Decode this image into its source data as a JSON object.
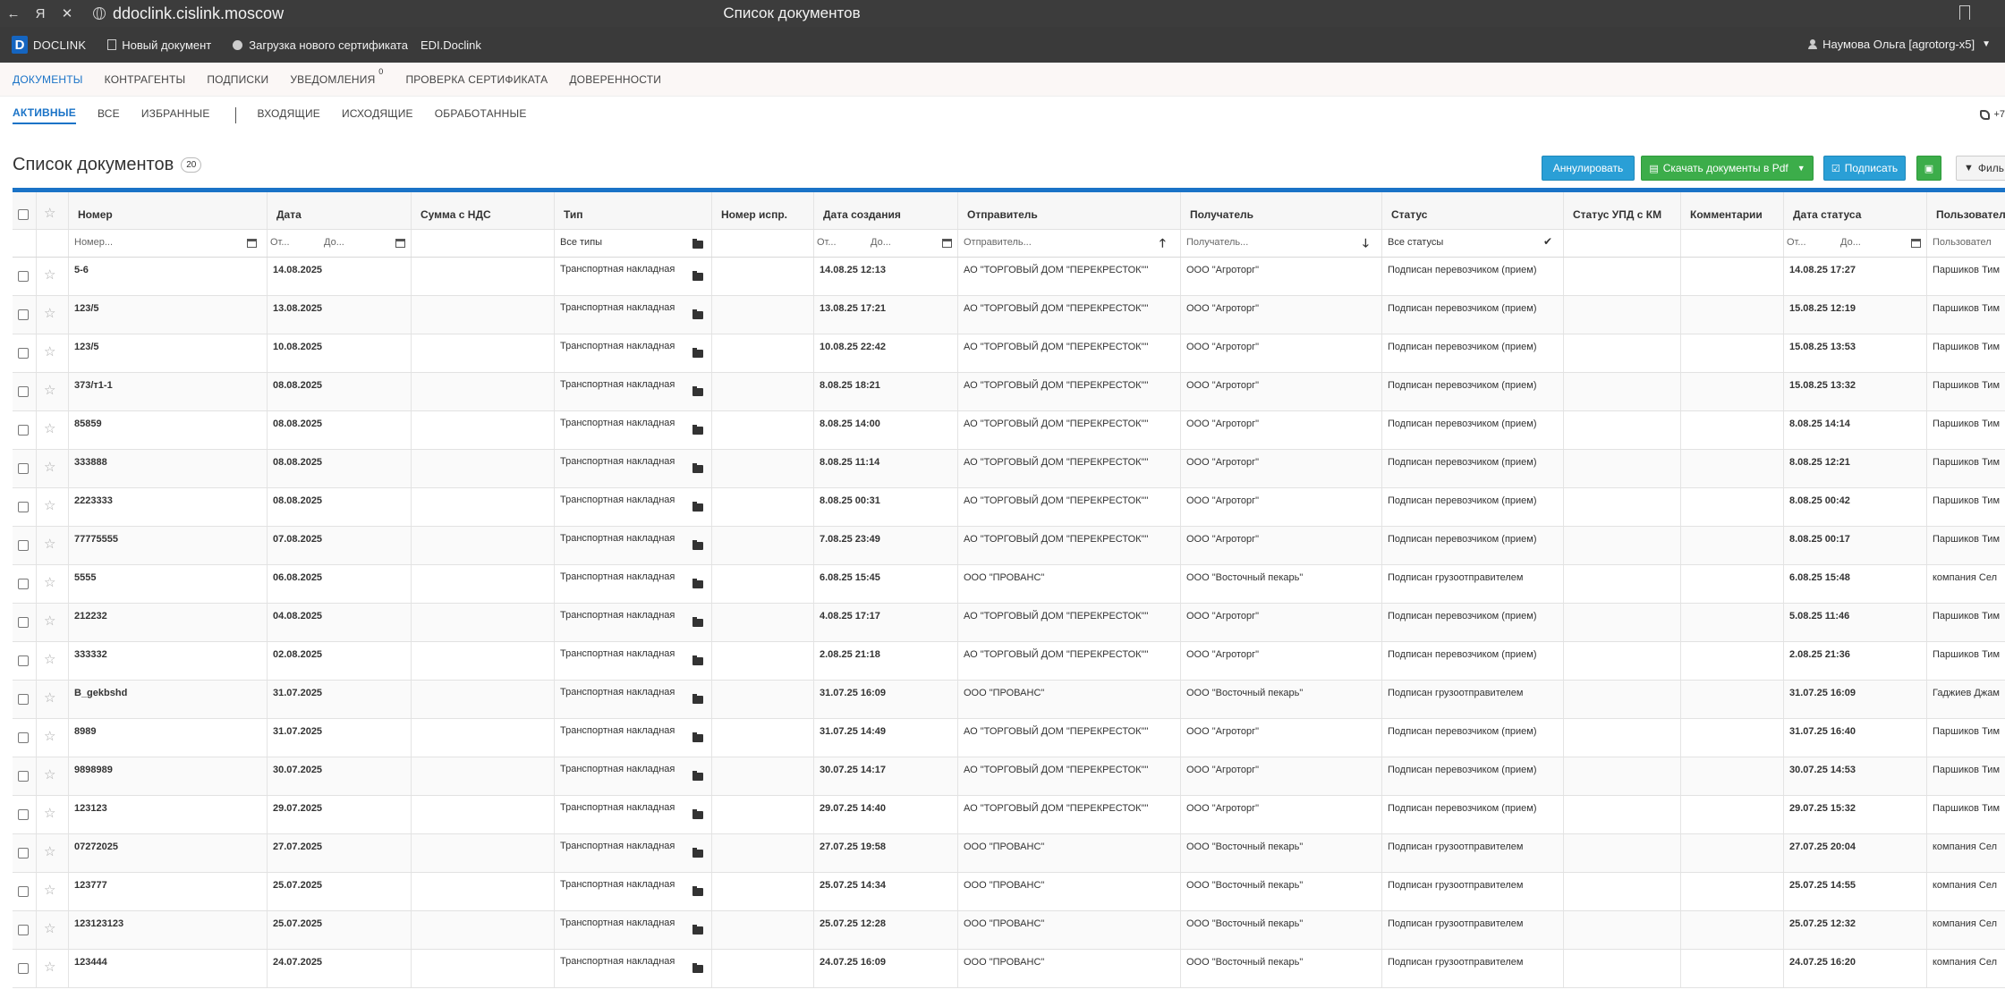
{
  "browser": {
    "url": "ddoclink.cislink.moscow",
    "tab_title": "Список документов"
  },
  "topbar": {
    "logo_letter": "D",
    "logo_text": "DOCLINK",
    "items": [
      "Новый документ",
      "Загрузка нового сертификата",
      "EDI.Doclink"
    ],
    "user": "Наумова Ольга [agrotorg-x5]"
  },
  "mainnav": {
    "items": [
      "ДОКУМЕНТЫ",
      "КОНТРАГЕНТЫ",
      "ПОДПИСКИ",
      "УВЕДОМЛЕНИЯ",
      "ПРОВЕРКА СЕРТИФИКАТА",
      "ДОВЕРЕННОСТИ"
    ],
    "notifications_count": "0"
  },
  "subnav": {
    "items": [
      "АКТИВНЫЕ",
      "ВСЕ",
      "ИЗБРАННЫЕ",
      "ВХОДЯЩИЕ",
      "ИСХОДЯЩИЕ",
      "ОБРАБОТАННЫЕ"
    ],
    "phone": "+7"
  },
  "page": {
    "title": "Список документов",
    "count": "20"
  },
  "toolbar": {
    "annul": "Аннулировать",
    "download_pdf": "Скачать документы в Pdf",
    "sign": "Подписать",
    "filter": "Филь"
  },
  "columns": [
    "Номер",
    "Дата",
    "Сумма с НДС",
    "Тип",
    "Номер испр.",
    "Дата создания",
    "Отправитель",
    "Получатель",
    "Статус",
    "Статус УПД с КМ",
    "Комментарии",
    "Дата статуса",
    "Пользовател"
  ],
  "filters": {
    "number_ph": "Номер...",
    "from": "От...",
    "to": "До...",
    "types": "Все типы",
    "sender_ph": "Отправитель...",
    "recipient_ph": "Получатель...",
    "statuses": "Все статусы",
    "user_ph": "Пользовател"
  },
  "rows": [
    [
      "5-6",
      "14.08.2025",
      "Транспортная накладная",
      "14.08.25 12:13",
      "АО \"ТОРГОВЫЙ ДОМ \"ПЕРЕКРЕСТОК\"\"",
      "ООО \"Агроторг\"",
      "Подписан перевозчиком (прием)",
      "14.08.25 17:27",
      "Паршиков Тим"
    ],
    [
      "123/5",
      "13.08.2025",
      "Транспортная накладная",
      "13.08.25 17:21",
      "АО \"ТОРГОВЫЙ ДОМ \"ПЕРЕКРЕСТОК\"\"",
      "ООО \"Агроторг\"",
      "Подписан перевозчиком (прием)",
      "15.08.25 12:19",
      "Паршиков Тим"
    ],
    [
      "123/5",
      "10.08.2025",
      "Транспортная накладная",
      "10.08.25 22:42",
      "АО \"ТОРГОВЫЙ ДОМ \"ПЕРЕКРЕСТОК\"\"",
      "ООО \"Агроторг\"",
      "Подписан перевозчиком (прием)",
      "15.08.25 13:53",
      "Паршиков Тим"
    ],
    [
      "373/т1-1",
      "08.08.2025",
      "Транспортная накладная",
      "8.08.25 18:21",
      "АО \"ТОРГОВЫЙ ДОМ \"ПЕРЕКРЕСТОК\"\"",
      "ООО \"Агроторг\"",
      "Подписан перевозчиком (прием)",
      "15.08.25 13:32",
      "Паршиков Тим"
    ],
    [
      "85859",
      "08.08.2025",
      "Транспортная накладная",
      "8.08.25 14:00",
      "АО \"ТОРГОВЫЙ ДОМ \"ПЕРЕКРЕСТОК\"\"",
      "ООО \"Агроторг\"",
      "Подписан перевозчиком (прием)",
      "8.08.25 14:14",
      "Паршиков Тим"
    ],
    [
      "333888",
      "08.08.2025",
      "Транспортная накладная",
      "8.08.25 11:14",
      "АО \"ТОРГОВЫЙ ДОМ \"ПЕРЕКРЕСТОК\"\"",
      "ООО \"Агроторг\"",
      "Подписан перевозчиком (прием)",
      "8.08.25 12:21",
      "Паршиков Тим"
    ],
    [
      "2223333",
      "08.08.2025",
      "Транспортная накладная",
      "8.08.25 00:31",
      "АО \"ТОРГОВЫЙ ДОМ \"ПЕРЕКРЕСТОК\"\"",
      "ООО \"Агроторг\"",
      "Подписан перевозчиком (прием)",
      "8.08.25 00:42",
      "Паршиков Тим"
    ],
    [
      "77775555",
      "07.08.2025",
      "Транспортная накладная",
      "7.08.25 23:49",
      "АО \"ТОРГОВЫЙ ДОМ \"ПЕРЕКРЕСТОК\"\"",
      "ООО \"Агроторг\"",
      "Подписан перевозчиком (прием)",
      "8.08.25 00:17",
      "Паршиков Тим"
    ],
    [
      "5555",
      "06.08.2025",
      "Транспортная накладная",
      "6.08.25 15:45",
      "ООО \"ПРОВАНС\"",
      "ООО \"Восточный пекарь\"",
      "Подписан грузоотправителем",
      "6.08.25 15:48",
      "компания Сел"
    ],
    [
      "212232",
      "04.08.2025",
      "Транспортная накладная",
      "4.08.25 17:17",
      "АО \"ТОРГОВЫЙ ДОМ \"ПЕРЕКРЕСТОК\"\"",
      "ООО \"Агроторг\"",
      "Подписан перевозчиком (прием)",
      "5.08.25 11:46",
      "Паршиков Тим"
    ],
    [
      "333332",
      "02.08.2025",
      "Транспортная накладная",
      "2.08.25 21:18",
      "АО \"ТОРГОВЫЙ ДОМ \"ПЕРЕКРЕСТОК\"\"",
      "ООО \"Агроторг\"",
      "Подписан перевозчиком (прием)",
      "2.08.25 21:36",
      "Паршиков Тим"
    ],
    [
      "B_gekbshd",
      "31.07.2025",
      "Транспортная накладная",
      "31.07.25 16:09",
      "ООО \"ПРОВАНС\"",
      "ООО \"Восточный пекарь\"",
      "Подписан грузоотправителем",
      "31.07.25 16:09",
      "Гаджиев Джам"
    ],
    [
      "8989",
      "31.07.2025",
      "Транспортная накладная",
      "31.07.25 14:49",
      "АО \"ТОРГОВЫЙ ДОМ \"ПЕРЕКРЕСТОК\"\"",
      "ООО \"Агроторг\"",
      "Подписан перевозчиком (прием)",
      "31.07.25 16:40",
      "Паршиков Тим"
    ],
    [
      "9898989",
      "30.07.2025",
      "Транспортная накладная",
      "30.07.25 14:17",
      "АО \"ТОРГОВЫЙ ДОМ \"ПЕРЕКРЕСТОК\"\"",
      "ООО \"Агроторг\"",
      "Подписан перевозчиком (прием)",
      "30.07.25 14:53",
      "Паршиков Тим"
    ],
    [
      "123123",
      "29.07.2025",
      "Транспортная накладная",
      "29.07.25 14:40",
      "АО \"ТОРГОВЫЙ ДОМ \"ПЕРЕКРЕСТОК\"\"",
      "ООО \"Агроторг\"",
      "Подписан перевозчиком (прием)",
      "29.07.25 15:32",
      "Паршиков Тим"
    ],
    [
      "07272025",
      "27.07.2025",
      "Транспортная накладная",
      "27.07.25 19:58",
      "ООО \"ПРОВАНС\"",
      "ООО \"Восточный пекарь\"",
      "Подписан грузоотправителем",
      "27.07.25 20:04",
      "компания Сел"
    ],
    [
      "123777",
      "25.07.2025",
      "Транспортная накладная",
      "25.07.25 14:34",
      "ООО \"ПРОВАНС\"",
      "ООО \"Восточный пекарь\"",
      "Подписан грузоотправителем",
      "25.07.25 14:55",
      "компания Сел"
    ],
    [
      "123123123",
      "25.07.2025",
      "Транспортная накладная",
      "25.07.25 12:28",
      "ООО \"ПРОВАНС\"",
      "ООО \"Восточный пекарь\"",
      "Подписан грузоотправителем",
      "25.07.25 12:32",
      "компания Сел"
    ],
    [
      "123444",
      "24.07.2025",
      "Транспортная накладная",
      "24.07.25 16:09",
      "ООО \"ПРОВАНС\"",
      "ООО \"Восточный пекарь\"",
      "Подписан грузоотправителем",
      "24.07.25 16:20",
      "компания Сел"
    ]
  ]
}
